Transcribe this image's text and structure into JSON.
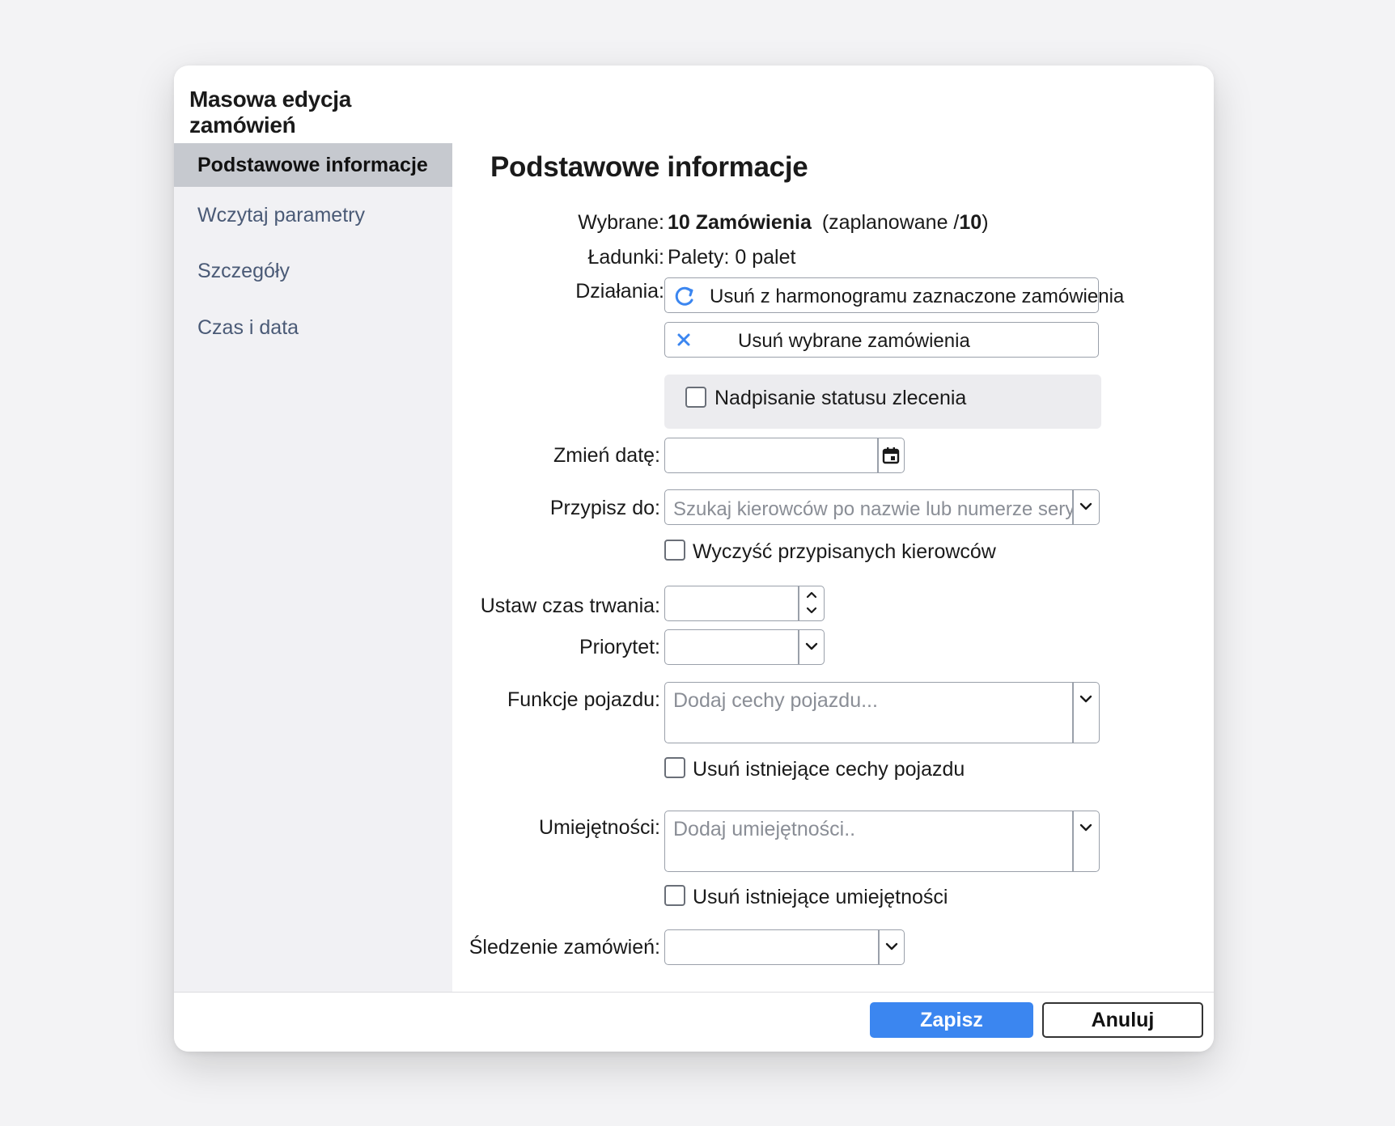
{
  "dialog": {
    "title": "Masowa edycja zamówień"
  },
  "sidebar": {
    "items": [
      {
        "label": "Podstawowe informacje",
        "active": true
      },
      {
        "label": "Wczytaj parametry",
        "active": false
      },
      {
        "label": "Szczegóły",
        "active": false
      },
      {
        "label": "Czas i data",
        "active": false
      }
    ]
  },
  "main": {
    "title": "Podstawowe informacje",
    "selected": {
      "label": "Wybrane:",
      "count": "10 Zamówienia",
      "planned_prefix": "(zaplanowane /",
      "planned_total": "10",
      "planned_suffix": ")"
    },
    "loads": {
      "label": "Ładunki:",
      "value": "Palety: 0 palet"
    },
    "actions": {
      "label": "Działania:",
      "unschedule": {
        "label": "Usuń z harmonogramu zaznaczone zamówienia",
        "icon": "refresh-icon"
      },
      "delete": {
        "label": "Usuń wybrane zamówienia",
        "icon": "close-icon"
      }
    },
    "override_status": {
      "label": "Nadpisanie statusu zlecenia",
      "checked": false
    },
    "change_date": {
      "label": "Zmień datę:",
      "value": "",
      "icon": "calendar-icon"
    },
    "assign_to": {
      "label": "Przypisz do:",
      "placeholder": "Szukaj kierowców po nazwie lub numerze seryjnym",
      "icon": "chevron-down-icon"
    },
    "clear_drivers": {
      "label": "Wyczyść przypisanych kierowców",
      "checked": false
    },
    "duration": {
      "label": "Ustaw czas trwania:",
      "value": ""
    },
    "priority": {
      "label": "Priorytet:",
      "value": ""
    },
    "vehicle_features": {
      "label": "Funkcje pojazdu:",
      "placeholder": "Dodaj cechy pojazdu..."
    },
    "remove_vehicle_features": {
      "label": "Usuń istniejące cechy pojazdu",
      "checked": false
    },
    "skills": {
      "label": "Umiejętności:",
      "placeholder": "Dodaj umiejętności.."
    },
    "remove_skills": {
      "label": "Usuń istniejące umiejętności",
      "checked": false
    },
    "tracking": {
      "label": "Śledzenie zamówień:",
      "value": ""
    }
  },
  "footer": {
    "save_label": "Zapisz",
    "cancel_label": "Anuluj"
  },
  "colors": {
    "primary": "#3b86f0",
    "sidebar_bg": "#f1f1f4",
    "active_nav": "#c6c9cf",
    "nav_text": "#4a5a76"
  }
}
